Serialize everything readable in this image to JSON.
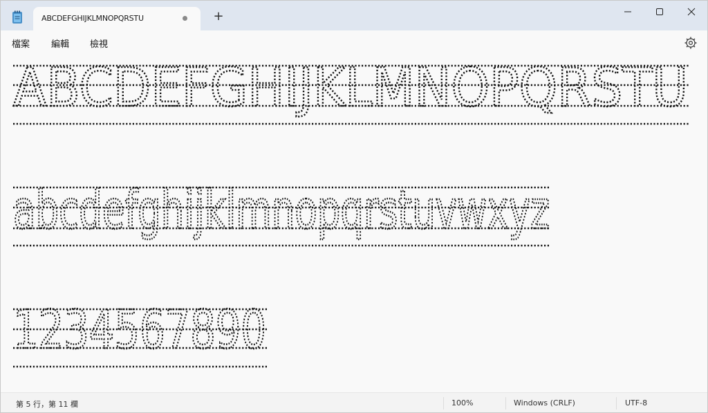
{
  "tab": {
    "title": "ABCDEFGHIJKLMNOPQRSTU"
  },
  "menu": {
    "file": "檔案",
    "edit": "編輯",
    "view": "檢視"
  },
  "editor": {
    "line1": "ABCDEFGHIJKLMNOPQRSTU",
    "line2": "abcdefghijklmnopqrstuvwxyz",
    "line3": "1234567890"
  },
  "status": {
    "position": "第 5 行，第 11 欄",
    "zoom": "100%",
    "line_ending": "Windows (CRLF)",
    "encoding": "UTF-8"
  },
  "icons": {
    "app": "notepad-icon",
    "new_tab": "plus-icon",
    "minimize": "minimize-icon",
    "maximize": "maximize-icon",
    "close": "close-icon",
    "settings": "gear-icon",
    "unsaved": "unsaved-dot-icon"
  }
}
